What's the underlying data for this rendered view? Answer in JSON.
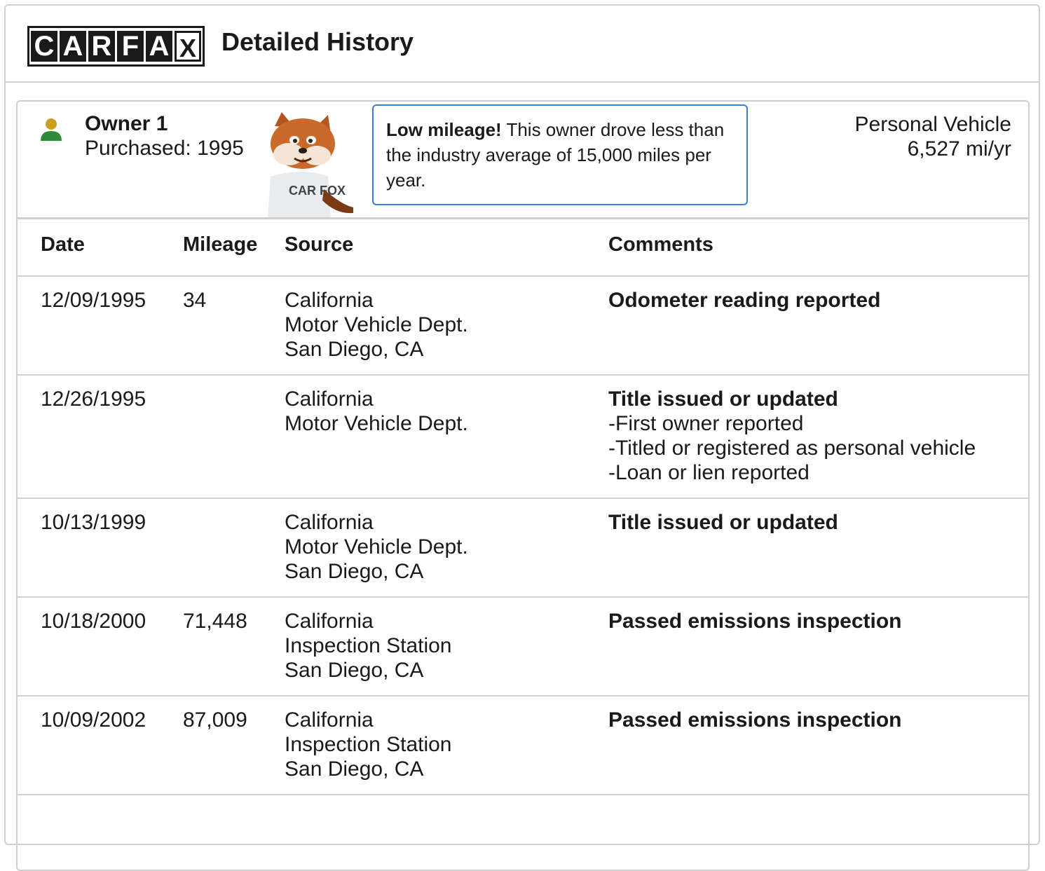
{
  "brand": {
    "logo_letters": [
      "C",
      "A",
      "R",
      "F",
      "A",
      "X"
    ]
  },
  "header": {
    "title": "Detailed History"
  },
  "owner": {
    "label": "Owner 1",
    "purchased": "Purchased: 1995",
    "callout_bold": "Low mileage!",
    "callout_text": " This owner drove less than the industry average of 15,000 miles per year.",
    "vehicle_type": "Personal Vehicle",
    "mileage_rate": "6,527 mi/yr",
    "fox_shirt_text": "CAR FOX"
  },
  "table": {
    "headers": {
      "date": "Date",
      "mileage": "Mileage",
      "source": "Source",
      "comments": "Comments"
    },
    "rows": [
      {
        "date": "12/09/1995",
        "mileage": "34",
        "source": [
          "California",
          "Motor Vehicle Dept.",
          "San Diego, CA"
        ],
        "comment_title": "Odometer reading reported",
        "comment_items": []
      },
      {
        "date": "12/26/1995",
        "mileage": "",
        "source": [
          "California",
          "Motor Vehicle Dept."
        ],
        "comment_title": "Title issued or updated",
        "comment_items": [
          "First owner reported",
          "Titled or registered as personal vehicle",
          "Loan or lien reported"
        ]
      },
      {
        "date": "10/13/1999",
        "mileage": "",
        "source": [
          "California",
          "Motor Vehicle Dept.",
          "San Diego, CA"
        ],
        "comment_title": "Title issued or updated",
        "comment_items": []
      },
      {
        "date": "10/18/2000",
        "mileage": "71,448",
        "source": [
          "California",
          "Inspection Station",
          "San Diego, CA"
        ],
        "comment_title": "Passed emissions inspection",
        "comment_items": []
      },
      {
        "date": "10/09/2002",
        "mileage": "87,009",
        "source": [
          "California",
          "Inspection Station",
          "San Diego, CA"
        ],
        "comment_title": "Passed emissions inspection",
        "comment_items": []
      }
    ]
  },
  "colors": {
    "callout_border": "#3b7fd6",
    "owner_head": "#c8a21a",
    "owner_body": "#2e8b3a",
    "divider": "#cfcfcf"
  }
}
